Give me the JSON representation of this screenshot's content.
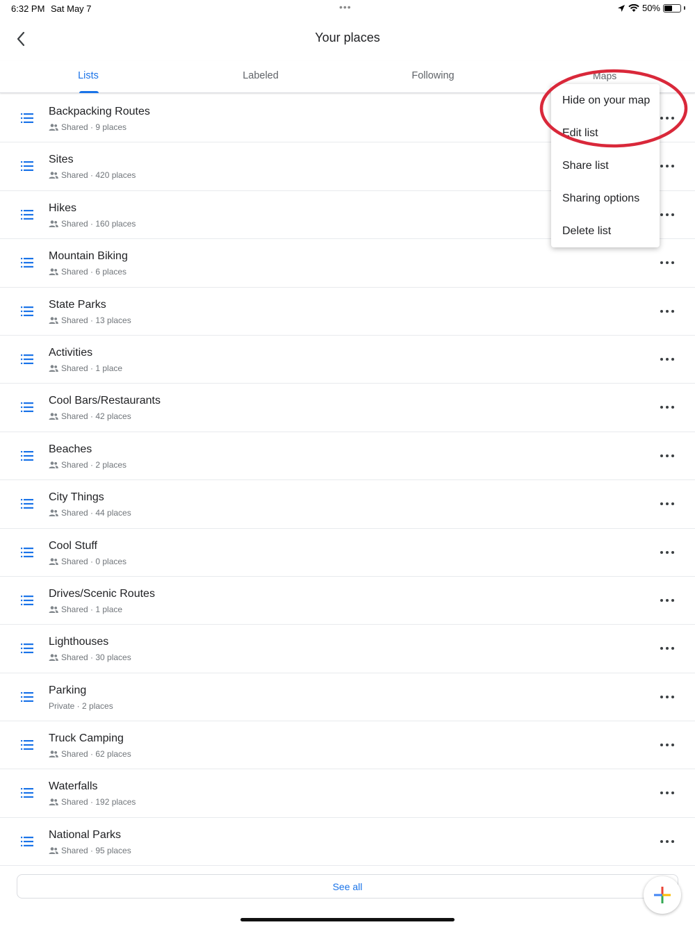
{
  "status_bar": {
    "time": "6:32 PM",
    "date": "Sat May 7",
    "dots": "•••",
    "battery": "50%",
    "battery_level": 0.5
  },
  "header": {
    "title": "Your places"
  },
  "tabs": [
    {
      "label": "Lists",
      "active": true
    },
    {
      "label": "Labeled",
      "active": false
    },
    {
      "label": "Following",
      "active": false
    },
    {
      "label": "Maps",
      "active": false
    }
  ],
  "lists": [
    {
      "title": "Backpacking Routes",
      "subtitle": "Shared · 9 places",
      "shared": true
    },
    {
      "title": "Sites",
      "subtitle": "Shared · 420 places",
      "shared": true
    },
    {
      "title": "Hikes",
      "subtitle": "Shared · 160 places",
      "shared": true
    },
    {
      "title": "Mountain Biking",
      "subtitle": "Shared · 6 places",
      "shared": true
    },
    {
      "title": "State Parks",
      "subtitle": "Shared · 13 places",
      "shared": true
    },
    {
      "title": "Activities",
      "subtitle": "Shared · 1 place",
      "shared": true
    },
    {
      "title": "Cool Bars/Restaurants",
      "subtitle": "Shared · 42 places",
      "shared": true
    },
    {
      "title": "Beaches",
      "subtitle": "Shared · 2 places",
      "shared": true
    },
    {
      "title": "City Things",
      "subtitle": "Shared · 44 places",
      "shared": true
    },
    {
      "title": "Cool Stuff",
      "subtitle": "Shared · 0 places",
      "shared": true
    },
    {
      "title": "Drives/Scenic Routes",
      "subtitle": "Shared · 1 place",
      "shared": true
    },
    {
      "title": "Lighthouses",
      "subtitle": "Shared · 30 places",
      "shared": true
    },
    {
      "title": "Parking",
      "subtitle": "Private · 2 places",
      "shared": false
    },
    {
      "title": "Truck Camping",
      "subtitle": "Shared · 62 places",
      "shared": true
    },
    {
      "title": "Waterfalls",
      "subtitle": "Shared · 192 places",
      "shared": true
    },
    {
      "title": "National Parks",
      "subtitle": "Shared · 95 places",
      "shared": true
    }
  ],
  "see_all": "See all",
  "context_menu": {
    "items": [
      "Hide on your map",
      "Edit list",
      "Share list",
      "Sharing options",
      "Delete list"
    ]
  },
  "icons": {
    "back": "back-arrow-icon",
    "list": "list-icon",
    "people": "people-icon",
    "more": "more-horizontal-icon",
    "add": "add-plus-icon"
  },
  "colors": {
    "accent": "#1a73e8",
    "annotation": "#d9283a"
  }
}
